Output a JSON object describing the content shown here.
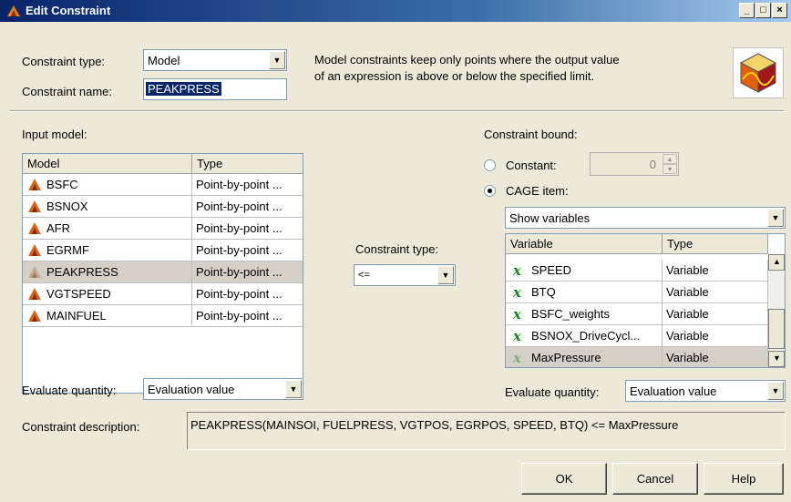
{
  "window": {
    "title": "Edit Constraint",
    "min": "_",
    "max": "□",
    "close": "×"
  },
  "constraint_type": {
    "label": "Constraint type:",
    "value": "Model"
  },
  "constraint_name": {
    "label": "Constraint name:",
    "value": "PEAKPRESS"
  },
  "description_text": {
    "line1": "Model constraints keep only points where the output value",
    "line2": "of an expression is above or below the specified limit."
  },
  "input_model": {
    "label": "Input model:",
    "columns": [
      "Model",
      "Type"
    ],
    "rows": [
      {
        "model": "BSFC",
        "type": "Point-by-point ..."
      },
      {
        "model": "BSNOX",
        "type": "Point-by-point ..."
      },
      {
        "model": "AFR",
        "type": "Point-by-point ..."
      },
      {
        "model": "EGRMF",
        "type": "Point-by-point ..."
      },
      {
        "model": "PEAKPRESS",
        "type": "Point-by-point ..."
      },
      {
        "model": "VGTSPEED",
        "type": "Point-by-point ..."
      },
      {
        "model": "MAINFUEL",
        "type": "Point-by-point ..."
      }
    ]
  },
  "middle": {
    "label": "Constraint type:",
    "value": "<="
  },
  "bound": {
    "label": "Constraint bound:",
    "constant_label": "Constant:",
    "constant_value": "0",
    "cage_label": "CAGE item:",
    "show_value": "Show variables",
    "columns": [
      "Variable",
      "Type"
    ],
    "rows": [
      {
        "name": "SPEED",
        "type": "Variable"
      },
      {
        "name": "BTQ",
        "type": "Variable"
      },
      {
        "name": "BSFC_weights",
        "type": "Variable"
      },
      {
        "name": "BSNOX_DriveCycl...",
        "type": "Variable"
      },
      {
        "name": "MaxPressure",
        "type": "Variable"
      }
    ]
  },
  "evaluate_left": {
    "label": "Evaluate quantity:",
    "value": "Evaluation value"
  },
  "evaluate_right": {
    "label": "Evaluate quantity:",
    "value": "Evaluation value"
  },
  "constraint_description": {
    "label": "Constraint description:",
    "value": "PEAKPRESS(MAINSOI, FUELPRESS, VGTPOS, EGRPOS, SPEED, BTQ) <= MaxPressure"
  },
  "buttons": {
    "ok": "OK",
    "cancel": "Cancel",
    "help": "Help"
  },
  "icons": {
    "arrow_down": "▼",
    "arrow_up": "▲",
    "x_glyph": "x"
  }
}
